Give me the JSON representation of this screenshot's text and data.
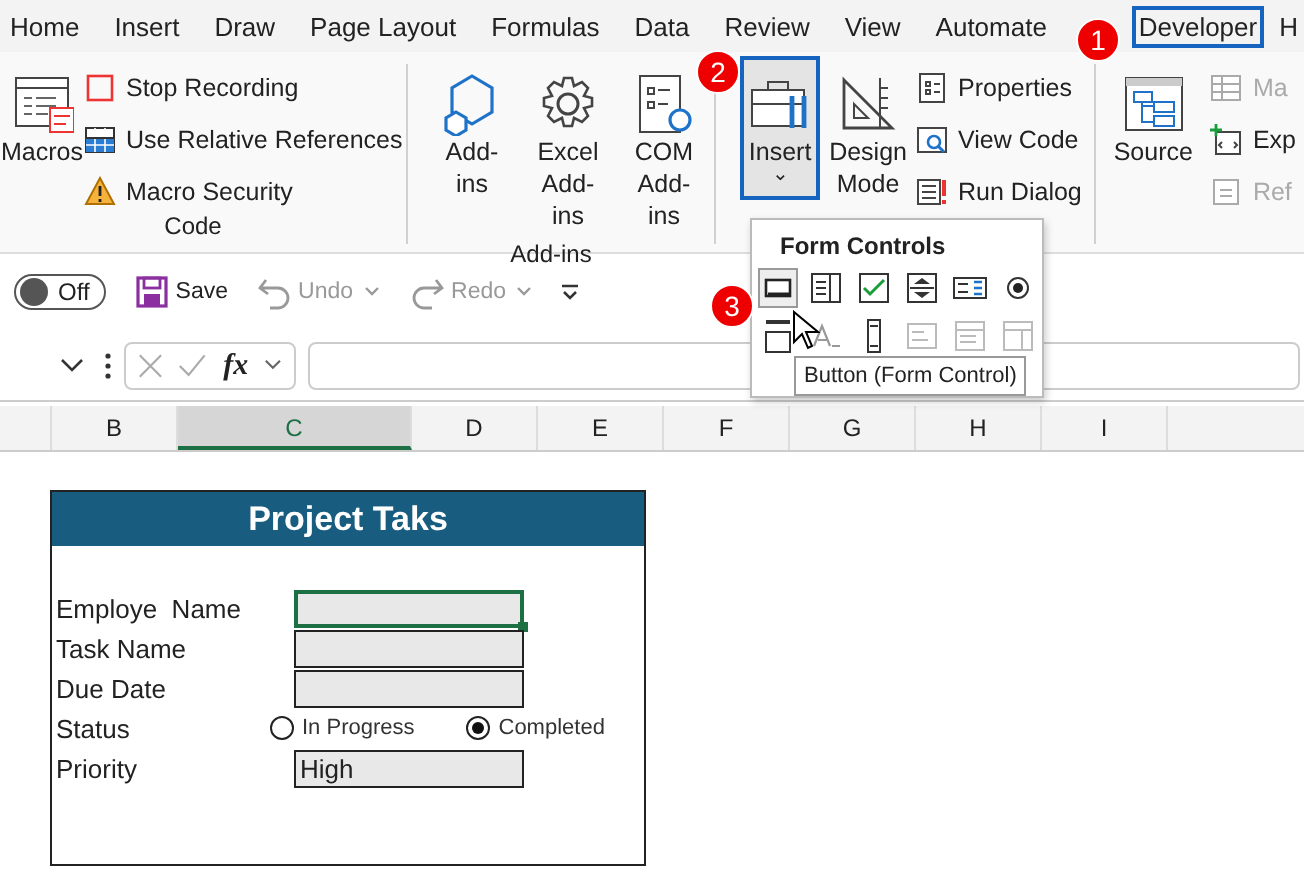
{
  "tabs": [
    {
      "label": "Home",
      "selected": false
    },
    {
      "label": "Insert",
      "selected": false
    },
    {
      "label": "Draw",
      "selected": false
    },
    {
      "label": "Page Layout",
      "selected": false
    },
    {
      "label": "Formulas",
      "selected": false
    },
    {
      "label": "Data",
      "selected": false
    },
    {
      "label": "Review",
      "selected": false
    },
    {
      "label": "View",
      "selected": false
    },
    {
      "label": "Automate",
      "selected": false
    },
    {
      "label": "Developer",
      "selected": true
    },
    {
      "label": "H",
      "selected": false
    }
  ],
  "ribbon": {
    "groups": [
      {
        "label": "Code",
        "large": [
          {
            "label": "Macros",
            "selected": false,
            "disabled": false
          }
        ],
        "small": [
          {
            "label": "Stop Recording",
            "disabled": false
          },
          {
            "label": "Use Relative References",
            "disabled": false
          },
          {
            "label": "Macro Security",
            "disabled": false
          }
        ]
      },
      {
        "label": "Add-ins",
        "large": [
          {
            "label": "Add-ins",
            "selected": false,
            "disabled": false
          },
          {
            "label": "Excel Add-ins",
            "selected": false,
            "disabled": false
          },
          {
            "label": "COM Add-ins",
            "selected": false,
            "disabled": false
          }
        ]
      },
      {
        "large": [
          {
            "label": "Insert",
            "selected": true,
            "disabled": false,
            "dropdown": "⌄"
          },
          {
            "label": "Design Mode",
            "selected": false,
            "disabled": false
          }
        ],
        "small": [
          {
            "label": "Properties",
            "disabled": false
          },
          {
            "label": "View Code",
            "disabled": false
          },
          {
            "label": "Run Dialog",
            "disabled": false
          }
        ]
      },
      {
        "large": [
          {
            "label": "Source",
            "selected": false,
            "disabled": false
          }
        ],
        "small": [
          {
            "label": "Ma",
            "disabled": true
          },
          {
            "label": "Exp",
            "disabled": false
          },
          {
            "label": "Ref",
            "disabled": true
          }
        ]
      }
    ]
  },
  "quick_access": {
    "autosave": {
      "label": "Off",
      "on": false
    },
    "items": [
      {
        "label": "Save",
        "disabled": false
      },
      {
        "label": "Undo",
        "disabled": true
      },
      {
        "label": "Redo",
        "disabled": true
      }
    ]
  },
  "formula_bar": {
    "fx": "fx"
  },
  "columns": [
    {
      "label": "B",
      "selected": false
    },
    {
      "label": "C",
      "selected": true
    },
    {
      "label": "D",
      "selected": false
    },
    {
      "label": "E",
      "selected": false
    },
    {
      "label": "F",
      "selected": false
    },
    {
      "label": "G",
      "selected": false
    },
    {
      "label": "H",
      "selected": false
    },
    {
      "label": "I",
      "selected": false
    }
  ],
  "form": {
    "title": "Project Taks",
    "rows": [
      {
        "kind": "field",
        "label": "Employe  Name",
        "value": "",
        "selected": true
      },
      {
        "kind": "field",
        "label": "Task Name",
        "value": "",
        "selected": false
      },
      {
        "kind": "field",
        "label": "Due Date",
        "value": "",
        "selected": false
      },
      {
        "kind": "radio",
        "label": "Status",
        "options": [
          {
            "label": "In Progress",
            "selected": false
          },
          {
            "label": "Completed",
            "selected": true
          }
        ]
      },
      {
        "kind": "field",
        "label": "Priority",
        "value": "High",
        "selected": false
      }
    ]
  },
  "popup": {
    "title": "Form Controls",
    "controls": [
      {
        "kind": "button",
        "selected": true
      },
      {
        "kind": "combo",
        "selected": false
      },
      {
        "kind": "checkbox",
        "selected": false
      },
      {
        "kind": "spin",
        "selected": false
      },
      {
        "kind": "listbox",
        "selected": false
      },
      {
        "kind": "option",
        "selected": false
      },
      {
        "kind": "group",
        "selected": false
      },
      {
        "kind": "label",
        "selected": false
      },
      {
        "kind": "scroll",
        "selected": false
      },
      {
        "kind": "textfield",
        "selected": false
      },
      {
        "kind": "combolist",
        "selected": false
      },
      {
        "kind": "combodrop",
        "selected": false
      }
    ]
  },
  "tooltip": "Button (Form Control)",
  "badges": [
    {
      "label": "1"
    },
    {
      "label": "2"
    },
    {
      "label": "3"
    }
  ]
}
